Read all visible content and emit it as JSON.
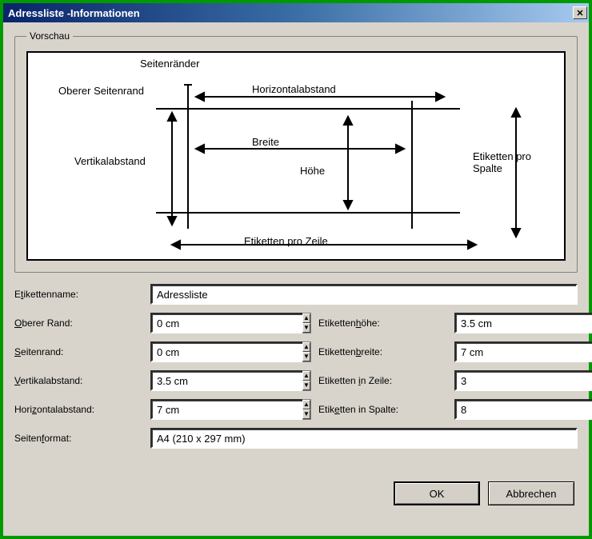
{
  "window": {
    "title": "Adressliste -Informationen",
    "close_glyph": "✕"
  },
  "preview": {
    "legend": "Vorschau",
    "labels": {
      "seitenraender": "Seitenränder",
      "oberer_seitenrand": "Oberer Seitenrand",
      "horizontalabstand": "Horizontalabstand",
      "vertikalabstand": "Vertikalabstand",
      "breite": "Breite",
      "hoehe": "Höhe",
      "etiketten_pro_spalte": "Etiketten pro\nSpalte",
      "etiketten_pro_zeile": "Etiketten pro Zeile"
    }
  },
  "fields": {
    "etikettenname": {
      "label_pre": "E",
      "label_u": "t",
      "label_post": "ikettenname:",
      "value": "Adressliste"
    },
    "oberer_rand": {
      "label_u": "O",
      "label_post": "berer Rand:",
      "value": "0 cm"
    },
    "seitenrand": {
      "label_u": "S",
      "label_post": "eitenrand:",
      "value": "0 cm"
    },
    "etikettenhoehe": {
      "label_pre": "Etiketten",
      "label_u": "h",
      "label_post": "öhe:",
      "value": "3.5 cm"
    },
    "etikettenbreite": {
      "label_pre": "Etiketten",
      "label_u": "b",
      "label_post": "reite:",
      "value": "7 cm"
    },
    "vertikalabstand": {
      "label_u": "V",
      "label_post": "ertikalabstand:",
      "value": "3.5 cm"
    },
    "horizontalabstand": {
      "label_pre": "Hori",
      "label_u": "z",
      "label_post": "ontalabstand:",
      "value": "7 cm"
    },
    "etiketten_in_zeile": {
      "label_pre": "Etiketten ",
      "label_u": "i",
      "label_post": "n Zeile:",
      "value": "3"
    },
    "etiketten_in_spalte": {
      "label_pre": "Etik",
      "label_u": "e",
      "label_post": "tten in Spalte:",
      "value": "8"
    },
    "seitenformat": {
      "label_pre": "Seiten",
      "label_u": "f",
      "label_post": "ormat:",
      "value": "A4 (210 x 297 mm)"
    }
  },
  "buttons": {
    "ok": "OK",
    "cancel": "Abbrechen"
  },
  "glyphs": {
    "up": "▲",
    "down": "▼"
  }
}
